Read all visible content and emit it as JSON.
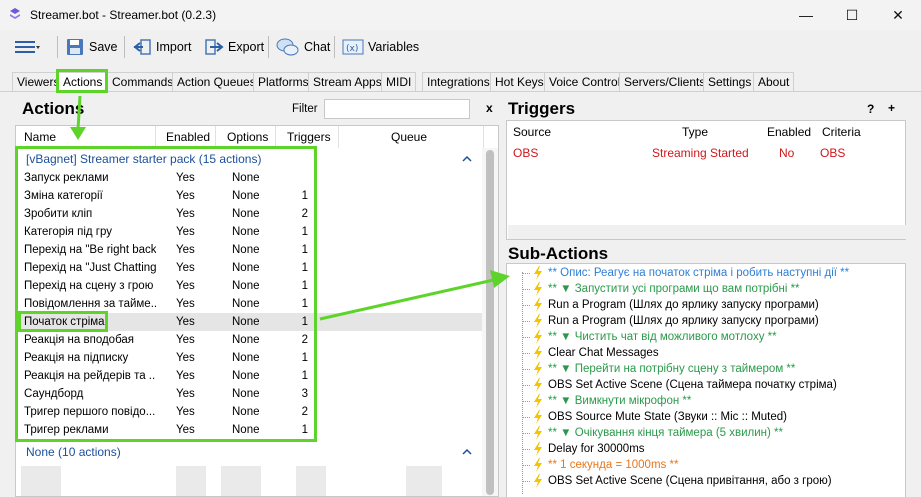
{
  "window": {
    "title": "Streamer.bot - Streamer.bot (0.2.3)",
    "minimize_glyph": "—",
    "maximize_glyph": "☐",
    "close_glyph": "✕"
  },
  "toolbar": {
    "save": "Save",
    "import": "Import",
    "export": "Export",
    "chat": "Chat",
    "variables": "Variables"
  },
  "tabs": [
    "Viewers",
    "Actions",
    "Commands",
    "Action Queues",
    "Platforms",
    "Stream Apps",
    "MIDI",
    "Integrations",
    "Hot Keys",
    "Voice Control",
    "Servers/Clients",
    "Settings",
    "About"
  ],
  "actions_panel": {
    "title": "Actions",
    "filter_label": "Filter",
    "filter_value": "",
    "filter_clear": "x",
    "columns": [
      "Name",
      "Enabled",
      "Options",
      "Triggers",
      "Queue"
    ],
    "group1": "[vBagnet] Streamer starter pack (15 actions)",
    "group2": "None (10 actions)",
    "rows": [
      {
        "name": "Запуск реклами",
        "enabled": "Yes",
        "options": "None",
        "triggers": ""
      },
      {
        "name": "Зміна категорії",
        "enabled": "Yes",
        "options": "None",
        "triggers": "1"
      },
      {
        "name": "Зробити кліп",
        "enabled": "Yes",
        "options": "None",
        "triggers": "2"
      },
      {
        "name": "Категорія під гру",
        "enabled": "Yes",
        "options": "None",
        "triggers": "1"
      },
      {
        "name": "Перехід на \"Be right back\"",
        "enabled": "Yes",
        "options": "None",
        "triggers": "1"
      },
      {
        "name": "Перехід на \"Just Chatting\"",
        "enabled": "Yes",
        "options": "None",
        "triggers": "1"
      },
      {
        "name": "Перехід на сцену з грою",
        "enabled": "Yes",
        "options": "None",
        "triggers": "1"
      },
      {
        "name": "Повідомлення за тайме...",
        "enabled": "Yes",
        "options": "None",
        "triggers": "1"
      },
      {
        "name": "Початок стріма",
        "enabled": "Yes",
        "options": "None",
        "triggers": "1"
      },
      {
        "name": "Реакція на вподобая",
        "enabled": "Yes",
        "options": "None",
        "triggers": "2"
      },
      {
        "name": "Реакція на підписку",
        "enabled": "Yes",
        "options": "None",
        "triggers": "1"
      },
      {
        "name": "Реакція на рейдерів та ...",
        "enabled": "Yes",
        "options": "None",
        "triggers": "1"
      },
      {
        "name": "Саундборд",
        "enabled": "Yes",
        "options": "None",
        "triggers": "3"
      },
      {
        "name": "Тригер першого повідо...",
        "enabled": "Yes",
        "options": "None",
        "triggers": "2"
      },
      {
        "name": "Тригер реклами",
        "enabled": "Yes",
        "options": "None",
        "triggers": "1"
      }
    ]
  },
  "triggers_panel": {
    "title": "Triggers",
    "help": "?",
    "add": "+",
    "columns": [
      "Source",
      "Type",
      "Enabled",
      "Criteria"
    ],
    "rows": [
      {
        "source": "OBS",
        "type": "Streaming Started",
        "enabled": "No",
        "criteria": "OBS"
      }
    ]
  },
  "subactions_panel": {
    "title": "Sub-Actions",
    "items": [
      {
        "text": "** Опис: Реагує на початок стріма і робить наступні дії **",
        "color": "#2f7fd6"
      },
      {
        "text": "** ▼ Запустити усі програми що вам потрібні **",
        "color": "#2a9a4a"
      },
      {
        "text": "Run a Program (Шлях до ярлику запуску програми)",
        "color": "#000000"
      },
      {
        "text": "Run a Program (Шлях до ярлику запуску програми)",
        "color": "#000000"
      },
      {
        "text": "** ▼ Чистить чат від можливого мотлоху **",
        "color": "#2a9a4a"
      },
      {
        "text": "Clear Chat Messages",
        "color": "#000000"
      },
      {
        "text": "** ▼ Перейти на потрібну сцену з таймером **",
        "color": "#2a9a4a"
      },
      {
        "text": "OBS Set Active Scene (Сцена таймера початку стріма)",
        "color": "#000000"
      },
      {
        "text": "** ▼ Вимкнути мікрофон **",
        "color": "#2a9a4a"
      },
      {
        "text": "OBS Source Mute State (Звуки :: Mic :: Muted)",
        "color": "#000000"
      },
      {
        "text": "** ▼ Очікування кінця таймера (5 хвилин) **",
        "color": "#2a9a4a"
      },
      {
        "text": "Delay for 30000ms",
        "color": "#000000"
      },
      {
        "text": "** 1 секунда = 1000ms **",
        "color": "#e8761a"
      },
      {
        "text": "OBS Set Active Scene (Сцена привітання, або з грою)",
        "color": "#000000"
      }
    ]
  },
  "colors": {
    "highlight": "#5ed42b",
    "group_text": "#1a4f9c",
    "trigger_red": "#d0161c",
    "bolt": "#f5c400"
  }
}
